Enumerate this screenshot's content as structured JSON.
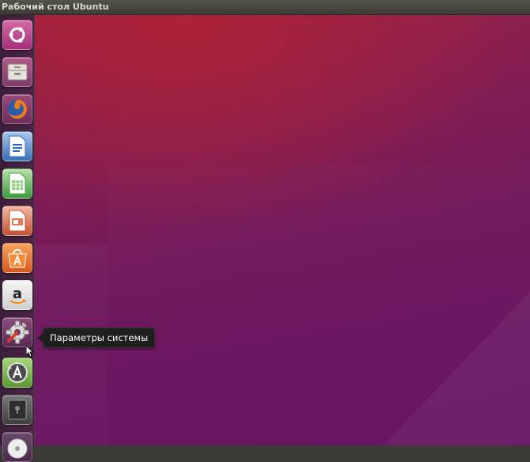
{
  "topbar": {
    "title": "Рабочий стол Ubuntu"
  },
  "tooltip": {
    "text": "Параметры системы"
  },
  "launcher": {
    "items": [
      {
        "icon": "ubuntu-dash-icon",
        "color": "#c93f8b"
      },
      {
        "icon": "files-icon",
        "color": "#d9d6d0"
      },
      {
        "icon": "firefox-icon",
        "color": "#e66000"
      },
      {
        "icon": "libreoffice-writer-icon",
        "color": "#2a6bbf"
      },
      {
        "icon": "libreoffice-calc-icon",
        "color": "#3fa73f"
      },
      {
        "icon": "libreoffice-impress-icon",
        "color": "#d04a2b"
      },
      {
        "icon": "ubuntu-software-icon",
        "color": "#ef7a26"
      },
      {
        "icon": "amazon-icon",
        "color": "#e8e8e8"
      },
      {
        "icon": "system-settings-icon",
        "color": "#6f6f6f"
      },
      {
        "icon": "software-updater-icon",
        "color": "#7ab547"
      },
      {
        "icon": "disk-icon",
        "color": "#555555"
      },
      {
        "icon": "dvd-icon",
        "color": "#dddddd"
      }
    ]
  }
}
